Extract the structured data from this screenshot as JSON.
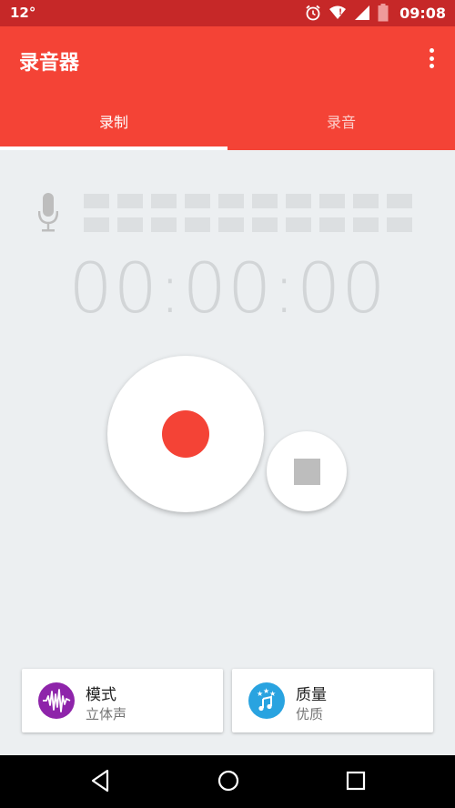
{
  "status_bar": {
    "temperature": "12°",
    "time": "09:08",
    "icons": [
      "alarm-icon",
      "wifi-icon",
      "signal-icon",
      "battery-icon"
    ]
  },
  "app_bar": {
    "title": "录音器",
    "overflow_icon": "more-vert-icon"
  },
  "tabs": [
    {
      "label": "录制",
      "active": true
    },
    {
      "label": "录音",
      "active": false
    }
  ],
  "recorder": {
    "mic_icon": "microphone-icon",
    "timer": "00:00:00",
    "record_button_icon": "record-dot-icon",
    "stop_button_icon": "stop-square-icon"
  },
  "options": {
    "mode": {
      "title": "模式",
      "value": "立体声",
      "icon": "waveform-icon",
      "color": "#8e24aa"
    },
    "quality": {
      "title": "质量",
      "value": "优质",
      "icon": "music-note-stars-icon",
      "color": "#29a3e0"
    }
  },
  "colors": {
    "accent": "#f44336",
    "status_bar": "#c62828"
  },
  "nav_bar": {
    "icons": [
      "back-icon",
      "home-icon",
      "recents-icon"
    ]
  }
}
